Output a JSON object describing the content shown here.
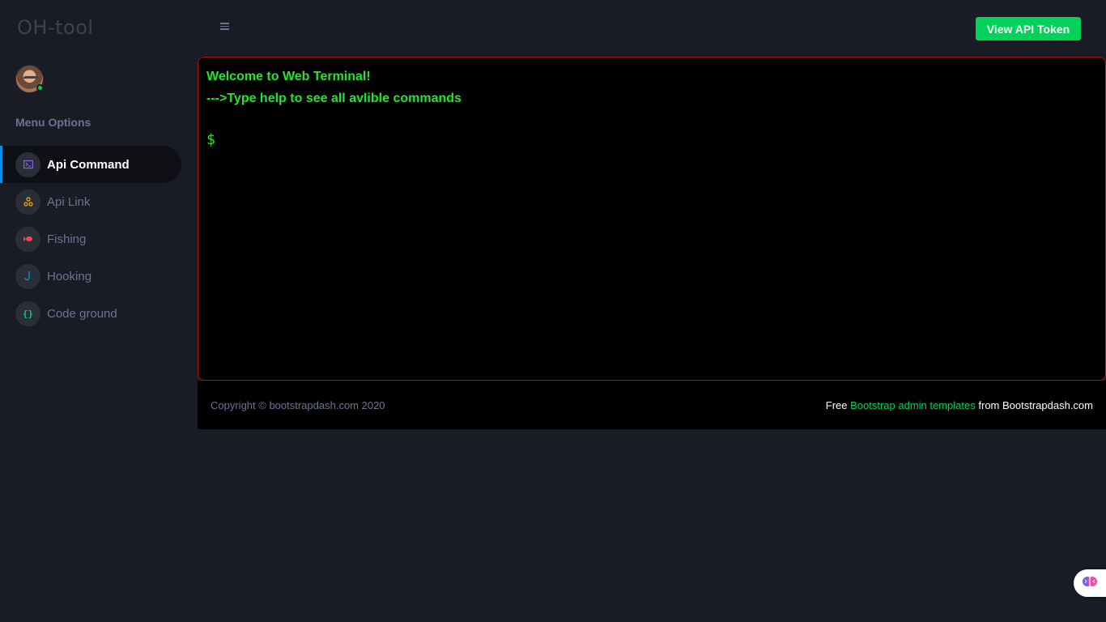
{
  "brand": {
    "title": "OH-tool"
  },
  "sidebar": {
    "menu_title": "Menu Options",
    "items": [
      {
        "label": "Api Command",
        "icon": "terminal-icon",
        "icon_glyph": ">_",
        "icon_color": "#8f5fe8",
        "active": true
      },
      {
        "label": "Api Link",
        "icon": "share-nodes-icon",
        "icon_glyph": "⁂",
        "icon_color": "#ffab00",
        "active": false
      },
      {
        "label": "Fishing",
        "icon": "fish-icon",
        "icon_glyph": "◀",
        "icon_color": "#fc424a",
        "active": false
      },
      {
        "label": "Hooking",
        "icon": "hook-icon",
        "icon_glyph": "J",
        "icon_color": "#0090e7",
        "active": false
      },
      {
        "label": "Code ground",
        "icon": "code-braces-icon",
        "icon_glyph": "{}",
        "icon_color": "#00d25b",
        "active": false
      }
    ]
  },
  "topbar": {
    "token_button": "View API Token"
  },
  "terminal": {
    "welcome": "Welcome to Web Terminal!",
    "hint": "--->Type help to see all avlible commands",
    "prompt": "$"
  },
  "footer": {
    "copyright": "Copyright © bootstrapdash.com 2020",
    "free_prefix": "Free",
    "link_text": "Bootstrap admin templates",
    "suffix": "from Bootstrapdash.com"
  },
  "colors": {
    "accent": "#00d25b",
    "terminal_text": "#21e62b",
    "terminal_border": "#a81616",
    "active_indicator": "#0090e7"
  }
}
